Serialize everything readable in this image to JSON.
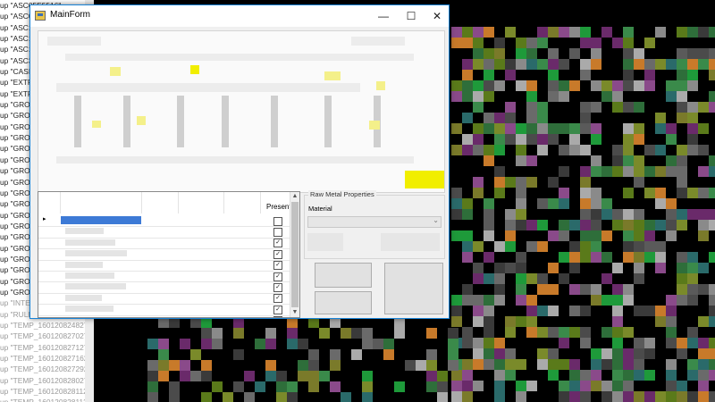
{
  "left_list": {
    "rows": [
      "up \"ASC05E5516\"",
      "up \"ASC0",
      "up \"ASC14",
      "up \"ASC14",
      "up \"ASC1C",
      "up \"ASC30",
      "up \"CASIN",
      "up \"EXTRA",
      "up \"EXTRA",
      "up \"GROUI",
      "up \"GROUI",
      "up \"GROUI",
      "up \"GROUI",
      "up \"GROUI",
      "up \"GROUI",
      "up \"GROUI",
      "up \"GROUI",
      "up \"GROUI",
      "up \"GROUI",
      "up \"GROUI",
      "up \"GROUI",
      "up \"GROUI",
      "up \"GROUI",
      "up \"GROUI",
      "up \"GROUI",
      "up \"GROUI",
      "up \"GROUI",
      "up \"INTER",
      "up \"RULLO",
      "up \"TEMP_1601208248270",
      "up \"TEMP_1601208270270",
      "up \"TEMP_1601208271270",
      "up \"TEMP_1601208271627",
      "up \"TEMP_1601208272927",
      "up \"TEMP_1601208280270",
      "up \"TEMP_1601208281127",
      "up \"TEMP_1601208281127"
    ]
  },
  "window": {
    "title": "MainForm",
    "minimize_glyph": "—",
    "maximize_glyph": "☐",
    "close_glyph": "✕"
  },
  "grid": {
    "present_header": "Present",
    "row_marker": "▸",
    "checkboxes": [
      false,
      false,
      true,
      true,
      true,
      true,
      true,
      true,
      true,
      false
    ],
    "check_glyph": "✓",
    "scroll_up": "▲",
    "scroll_down": "▼"
  },
  "raw_metal": {
    "group_title": "Raw Metal Properties",
    "material_label": "Material",
    "dropdown_glyph": "⌄"
  }
}
